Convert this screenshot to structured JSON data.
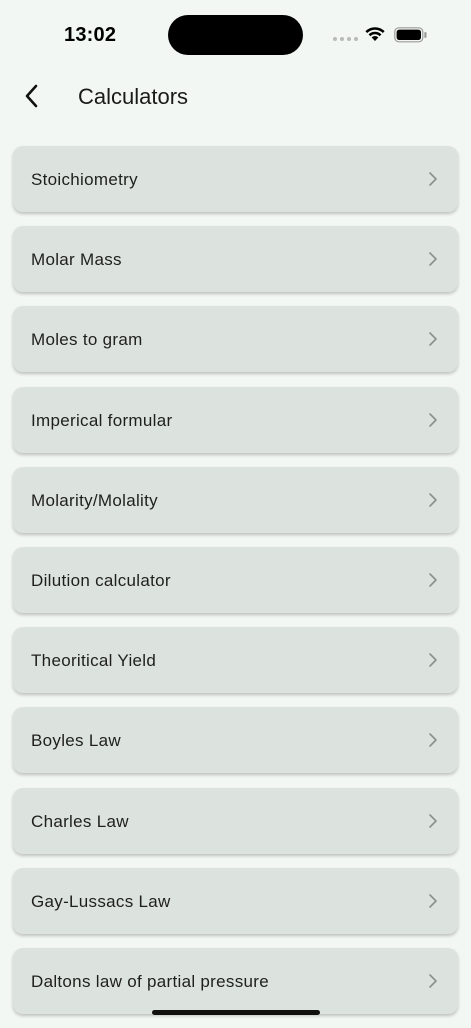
{
  "status_bar": {
    "time": "13:02"
  },
  "header": {
    "back_icon": "chevron-left-icon",
    "title": "Calculators"
  },
  "calculators": [
    {
      "label": "Stoichiometry"
    },
    {
      "label": "Molar Mass"
    },
    {
      "label": "Moles to gram"
    },
    {
      "label": "Imperical formular"
    },
    {
      "label": "Molarity/Molality"
    },
    {
      "label": "Dilution calculator"
    },
    {
      "label": "Theoritical Yield"
    },
    {
      "label": "Boyles Law"
    },
    {
      "label": "Charles Law"
    },
    {
      "label": "Gay-Lussacs Law"
    },
    {
      "label": "Daltons law of partial pressure"
    }
  ],
  "colors": {
    "background": "#f3f7f4",
    "card": "#dce3df",
    "chevron": "#8a8f8c"
  }
}
